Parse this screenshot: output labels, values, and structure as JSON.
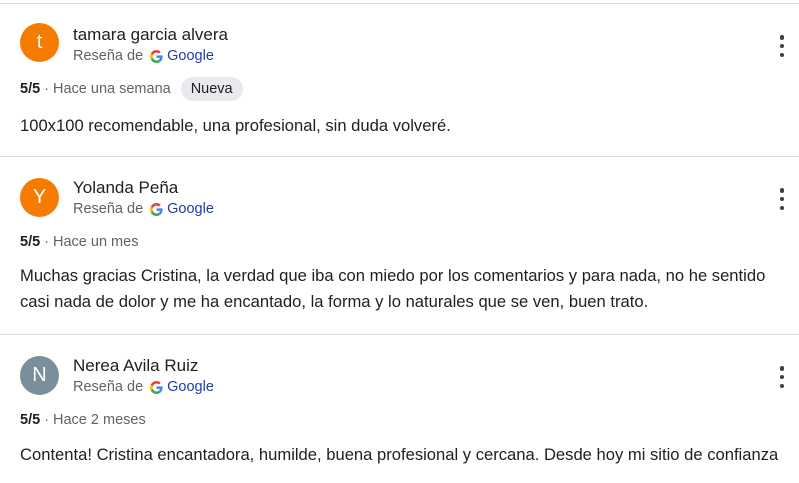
{
  "reviews": [
    {
      "initial": "t",
      "avatar_color": "#f57c00",
      "author": "tamara garcia alvera",
      "source_prefix": "Reseña de",
      "source_name": "Google",
      "rating": "5/5",
      "separator": "·",
      "time": "Hace una semana",
      "badge": "Nueva",
      "text": "100x100 recomendable, una profesional, sin duda volveré."
    },
    {
      "initial": "Y",
      "avatar_color": "#f57c00",
      "author": "Yolanda Peña",
      "source_prefix": "Reseña de",
      "source_name": "Google",
      "rating": "5/5",
      "separator": "·",
      "time": "Hace un mes",
      "text": "Muchas gracias Cristina, la verdad que iba con miedo por los comentarios y para nada, no he sentido casi nada de dolor y me ha encantado, la forma y lo naturales que se ven, buen trato."
    },
    {
      "initial": "N",
      "avatar_color": "#78909c",
      "author": "Nerea Avila Ruiz",
      "source_prefix": "Reseña de",
      "source_name": "Google",
      "rating": "5/5",
      "separator": "·",
      "time": "Hace 2 meses",
      "text": "Contenta! Cristina encantadora, humilde, buena profesional y cercana. Desde hoy mi sitio de confianza"
    }
  ]
}
